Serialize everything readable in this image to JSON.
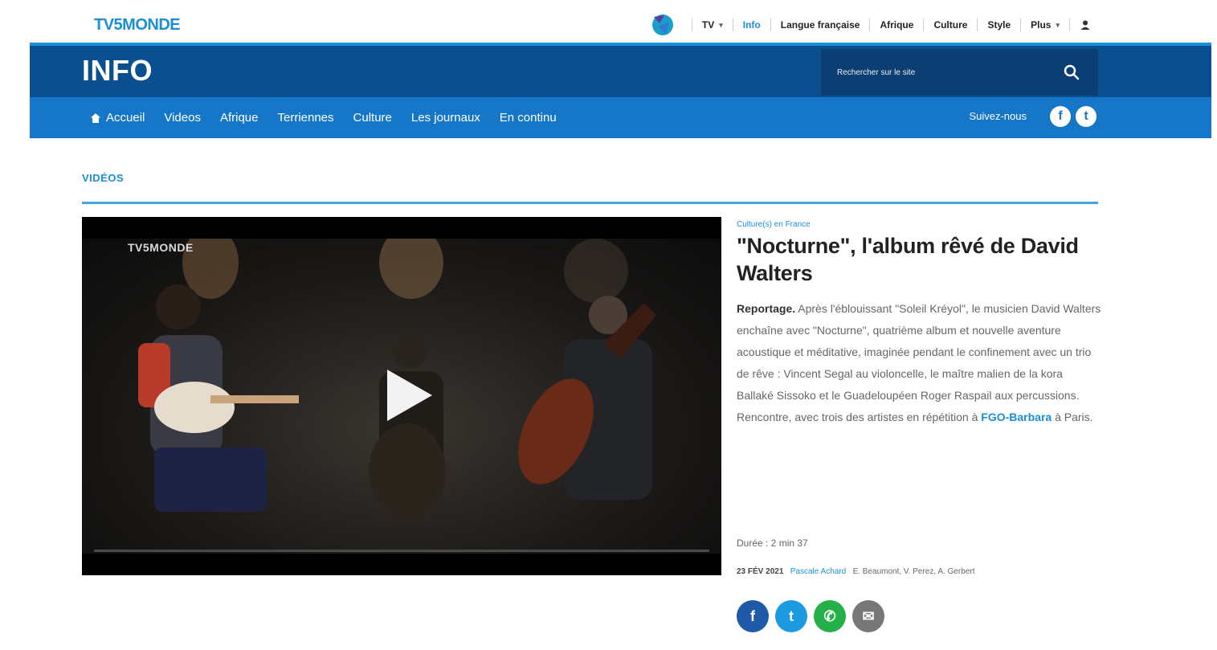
{
  "brand": "TV5MONDE",
  "topnav": {
    "items": [
      {
        "label": "TV",
        "dropdown": true,
        "active": false
      },
      {
        "label": "Info",
        "dropdown": false,
        "active": true
      },
      {
        "label": "Langue française",
        "dropdown": false,
        "active": false
      },
      {
        "label": "Afrique",
        "dropdown": false,
        "active": false
      },
      {
        "label": "Culture",
        "dropdown": false,
        "active": false
      },
      {
        "label": "Style",
        "dropdown": false,
        "active": false
      },
      {
        "label": "Plus",
        "dropdown": true,
        "active": false
      }
    ],
    "caret": "▾",
    "user_icon": "user-icon"
  },
  "header": {
    "title": "INFO",
    "search_placeholder": "Rechercher sur le site"
  },
  "subnav": {
    "links": [
      "Accueil",
      "Videos",
      "Afrique",
      "Terriennes",
      "Culture",
      "Les journaux",
      "En continu"
    ],
    "follow_label": "Suivez-nous",
    "facebook_glyph": "f",
    "twitter_glyph": "t"
  },
  "content": {
    "section_label": "VIDÉOS",
    "video": {
      "watermark": "TV5MONDE",
      "progress": 0
    },
    "kicker": "Culture(s) en France",
    "headline": "\"Nocturne\", l'album rêvé de David Walters",
    "summary_lead": "Reportage.",
    "summary_body": " Après l'éblouissant \"Soleil Kréyol\", le musicien David Walters enchaîne avec \"Nocturne\", quatrième album et nouvelle aventure acoustique et méditative, imaginée pendant le confinement avec un trio de rêve : Vincent Segal au violoncelle, le maître malien de la kora Ballaké Sissoko et le Guadeloupéen Roger Raspail aux percussions. Rencontre, avec trois des artistes en répétition à ",
    "summary_link": "FGO-Barbara",
    "summary_end": " à Paris.",
    "duration": "Durée : 2 min 37",
    "date": "23 FÉV 2021",
    "author": "Pascale Achard",
    "crew": "E. Beaumont, V. Perez, A. Gerbert"
  },
  "share": {
    "buttons": [
      {
        "name": "facebook",
        "color": "#1e5aa8",
        "glyph": "f"
      },
      {
        "name": "twitter",
        "color": "#1d9be0",
        "glyph": "t"
      },
      {
        "name": "whatsapp",
        "color": "#25b04a",
        "glyph": "✆"
      },
      {
        "name": "email",
        "color": "#777777",
        "glyph": "✉"
      }
    ]
  },
  "colors": {
    "brand_blue": "#1a8fd6",
    "header_dark": "#0a4f8f",
    "subnav_blue": "#1677c9"
  }
}
